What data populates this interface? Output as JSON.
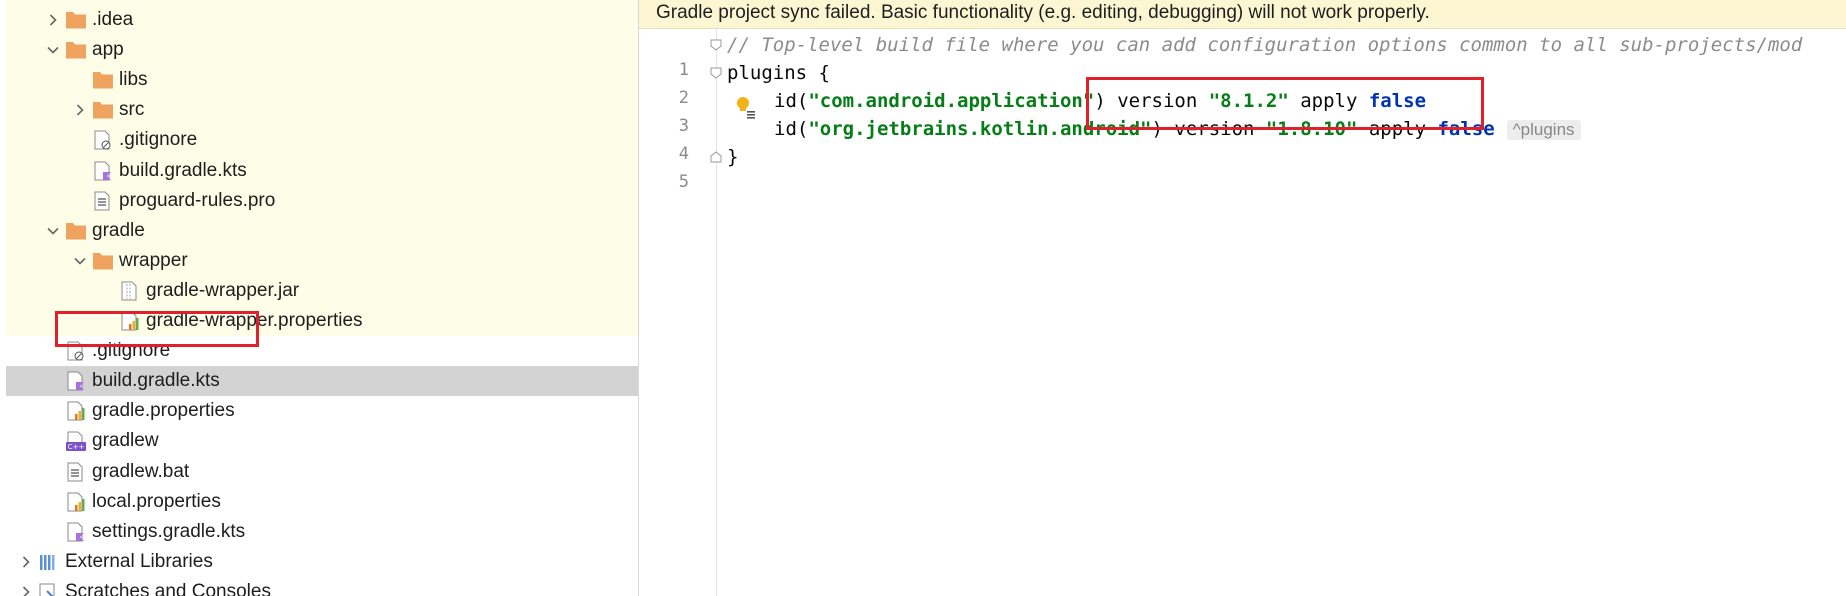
{
  "project_tree": {
    "items": [
      {
        "label": ".idea",
        "icon": "folder-icon",
        "expander": "collapsed"
      },
      {
        "label": "app",
        "icon": "folder-icon",
        "expander": "expanded"
      },
      {
        "label": "libs",
        "icon": "folder-icon",
        "expander": "none"
      },
      {
        "label": "src",
        "icon": "folder-icon",
        "expander": "collapsed"
      },
      {
        "label": ".gitignore",
        "icon": "gitignore-file-icon",
        "expander": "none"
      },
      {
        "label": "build.gradle.kts",
        "icon": "kotlin-script-file-icon",
        "expander": "none"
      },
      {
        "label": "proguard-rules.pro",
        "icon": "text-file-icon",
        "expander": "none"
      },
      {
        "label": "gradle",
        "icon": "folder-icon",
        "expander": "expanded"
      },
      {
        "label": "wrapper",
        "icon": "folder-icon",
        "expander": "expanded"
      },
      {
        "label": "gradle-wrapper.jar",
        "icon": "jar-file-icon",
        "expander": "none"
      },
      {
        "label": "gradle-wrapper.properties",
        "icon": "properties-file-icon",
        "expander": "none"
      },
      {
        "label": ".gitignore",
        "icon": "gitignore-file-icon",
        "expander": "none"
      },
      {
        "label": "build.gradle.kts",
        "icon": "kotlin-script-file-icon",
        "expander": "none",
        "selected": true
      },
      {
        "label": "gradle.properties",
        "icon": "properties-file-icon",
        "expander": "none"
      },
      {
        "label": "gradlew",
        "icon": "shell-script-file-icon",
        "expander": "none"
      },
      {
        "label": "gradlew.bat",
        "icon": "text-file-icon",
        "expander": "none"
      },
      {
        "label": "local.properties",
        "icon": "properties-file-icon",
        "expander": "none"
      },
      {
        "label": "settings.gradle.kts",
        "icon": "kotlin-script-file-icon",
        "expander": "none"
      },
      {
        "label": "External Libraries",
        "icon": "libraries-icon",
        "expander": "collapsed"
      },
      {
        "label": "Scratches and Consoles",
        "icon": "scratches-icon",
        "expander": "collapsed"
      }
    ]
  },
  "editor": {
    "banner": "Gradle project sync failed. Basic functionality (e.g. editing, debugging) will not work properly.",
    "line_numbers": [
      "1",
      "2",
      "3",
      "4",
      "5"
    ],
    "code": {
      "l1_comment": "// Top-level build file where you can add configuration options common to all sub-projects/mod",
      "l2_plugins": "plugins",
      "l2_brace": " {",
      "l3_id": "id(",
      "l3_plugin": "\"com.android.application\"",
      "l3_mid": ") version ",
      "l3_version": "\"8.1.2\"",
      "l3_apply": " apply ",
      "l3_false": "false",
      "l4_id": "id(",
      "l4_plugin": "\"org.jetbrains.kotlin.android\"",
      "l4_mid": ") version ",
      "l4_version": "\"1.8.10\"",
      "l4_apply": " apply ",
      "l4_false": "false",
      "l4_hint": "^plugins",
      "l5_brace": "}"
    }
  },
  "colors": {
    "highlight_red": "#e0202a",
    "string_green": "#067d17",
    "keyword_blue": "#0033b3",
    "folder_orange": "#f0a35e"
  }
}
